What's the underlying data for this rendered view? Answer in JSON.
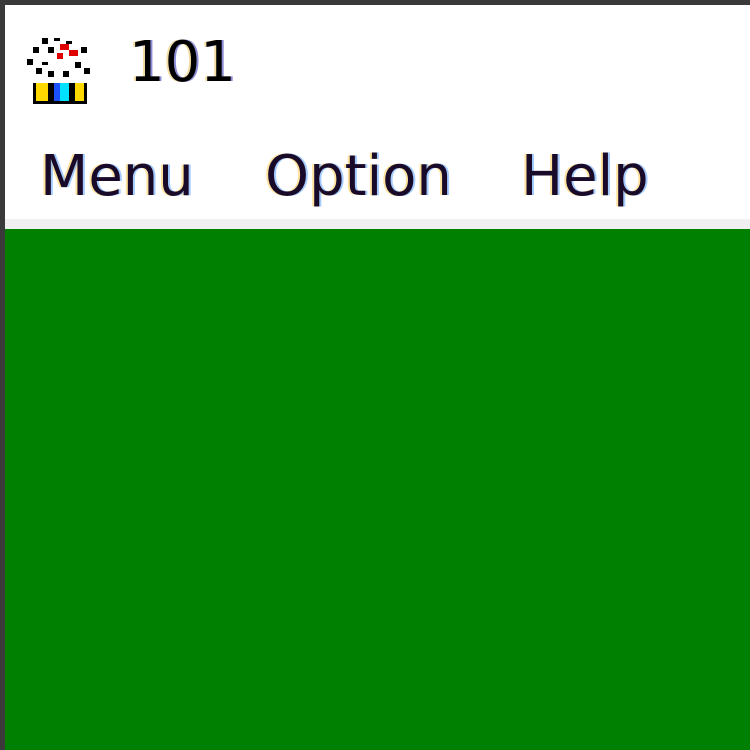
{
  "window": {
    "title": "101",
    "icon": "playing-cards-app-icon"
  },
  "menubar": {
    "items": [
      {
        "label": "Menu"
      },
      {
        "label": "Option"
      },
      {
        "label": "Help"
      }
    ]
  },
  "colors": {
    "felt": "#008000",
    "window_background": "#ffffff",
    "menubar_separator": "#f0f0f0"
  }
}
